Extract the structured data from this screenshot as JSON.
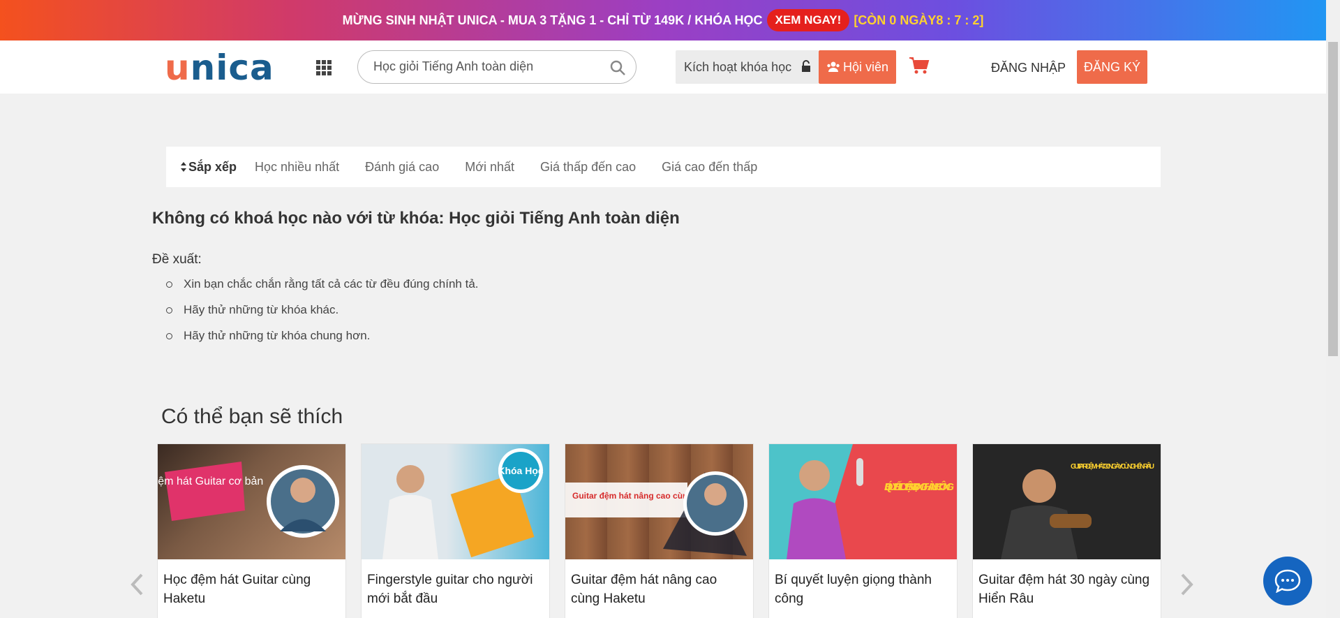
{
  "promo": {
    "text": "MỪNG SINH NHẬT UNICA - MUA 3 TẶNG 1 - CHỈ TỪ 149K / KHÓA HỌC",
    "button": "XEM NGAY!",
    "countdown": "[CÒN 0 NGÀY8 : 7 : 2]"
  },
  "header": {
    "search_value": "Học giỏi Tiếng Anh toàn diện",
    "activate_label": "Kích hoạt khóa học",
    "member_label": "Hội viên",
    "login_label": "ĐĂNG NHẬP",
    "register_label": "ĐĂNG KÝ"
  },
  "sort": {
    "title": "Sắp xếp",
    "options": [
      "Học nhiều nhất",
      "Đánh giá cao",
      "Mới nhất",
      "Giá thấp đến cao",
      "Giá cao đến thấp"
    ]
  },
  "results": {
    "no_result_text": "Không có khoá học nào với từ khóa: Học giỏi Tiếng Anh toàn diện",
    "suggest_label": "Đề xuất:",
    "suggestions": [
      "Xin bạn chắc chắn rằng tất cả các từ đều đúng chính tả.",
      "Hãy thử những từ khóa khác.",
      "Hãy thử những từ khóa chung hơn."
    ]
  },
  "recommend": {
    "title": "Có thể bạn sẽ thích",
    "courses": [
      {
        "title": "Học đệm hát Guitar cùng Haketu",
        "image_text": "Đệm hát Guitar cơ bản"
      },
      {
        "title": "Fingerstyle guitar cho người mới bắt đầu",
        "image_text": "Khóa Học"
      },
      {
        "title": "Guitar đệm hát nâng cao cùng Haketu",
        "image_text": "Guitar đệm hát nâng cao cùng Haketu"
      },
      {
        "title": "Bí quyết luyện giọng thành công",
        "image_text": "BÍ QUYẾT LUYỆN GIỌNG THÀNH CÔNG"
      },
      {
        "title": "Guitar đệm hát 30 ngày cùng Hiển Râu",
        "image_text": "GUITAR ĐỆM HÁT 30 NGÀY CÙNG HIỂN RÂU"
      }
    ]
  },
  "colors": {
    "accent": "#ef6b4a",
    "brand_blue": "#1a5d8e",
    "chat": "#1565c0"
  }
}
